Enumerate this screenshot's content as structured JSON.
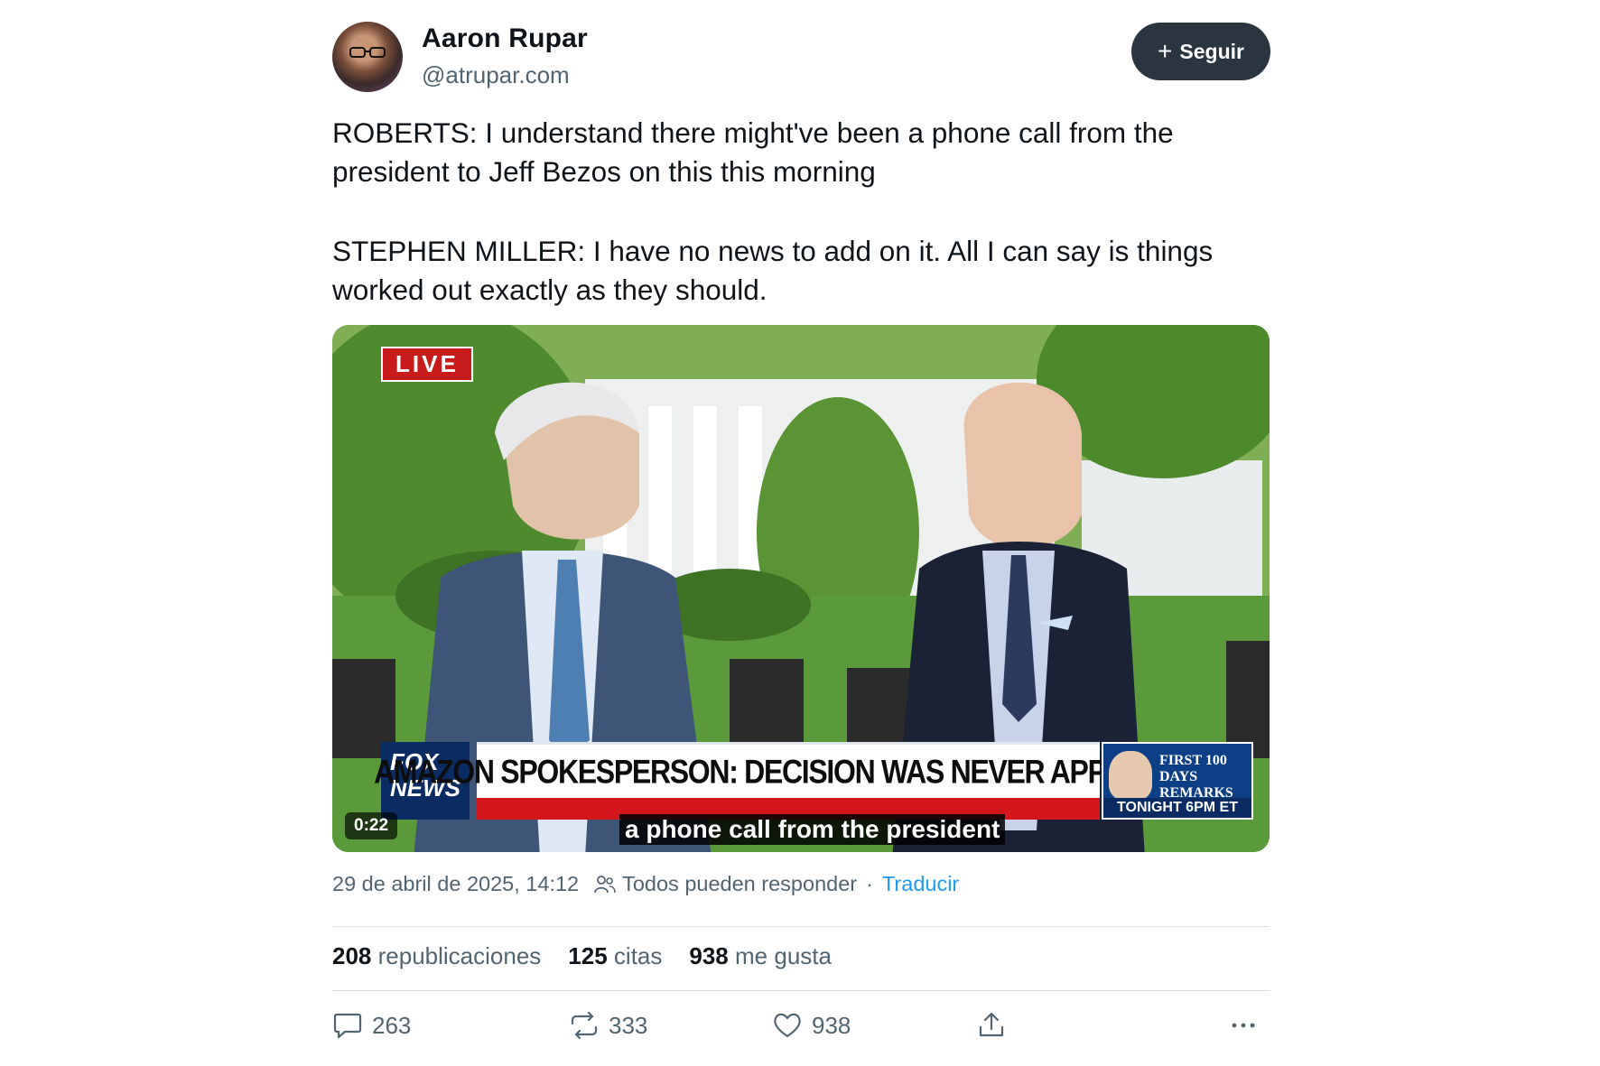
{
  "author": {
    "name": "Aaron Rupar",
    "handle": "@atrupar.com"
  },
  "follow_button": {
    "icon": "plus-icon",
    "label": "Seguir"
  },
  "post": {
    "paragraph_1": "ROBERTS: I understand there might've been a phone call from the president to Jeff Bezos on this this morning",
    "paragraph_2": "STEPHEN MILLER: I have no news to add on it. All I can say is things worked out exactly as they should."
  },
  "video": {
    "live_badge": "LIVE",
    "chyron": "AMAZON SPOKESPERSON: DECISION WAS NEVER APPROVED",
    "network_logo": "FOX NEWS",
    "subtitle": "a phone call from the president",
    "timestamp": "0:22",
    "promo_line": "FIRST 100 DAYS REMARKS",
    "promo_bar": "TONIGHT 6PM ET"
  },
  "meta": {
    "date": "29 de abril de 2025, 14:12",
    "reply_setting": "Todos pueden responder",
    "separator": "·",
    "translate": "Traducir"
  },
  "stats": {
    "reposts_count": "208",
    "reposts_label": "republicaciones",
    "quotes_count": "125",
    "quotes_label": "citas",
    "likes_count": "938",
    "likes_label": "me gusta"
  },
  "actions": {
    "replies": "263",
    "reposts": "333",
    "likes": "938"
  }
}
